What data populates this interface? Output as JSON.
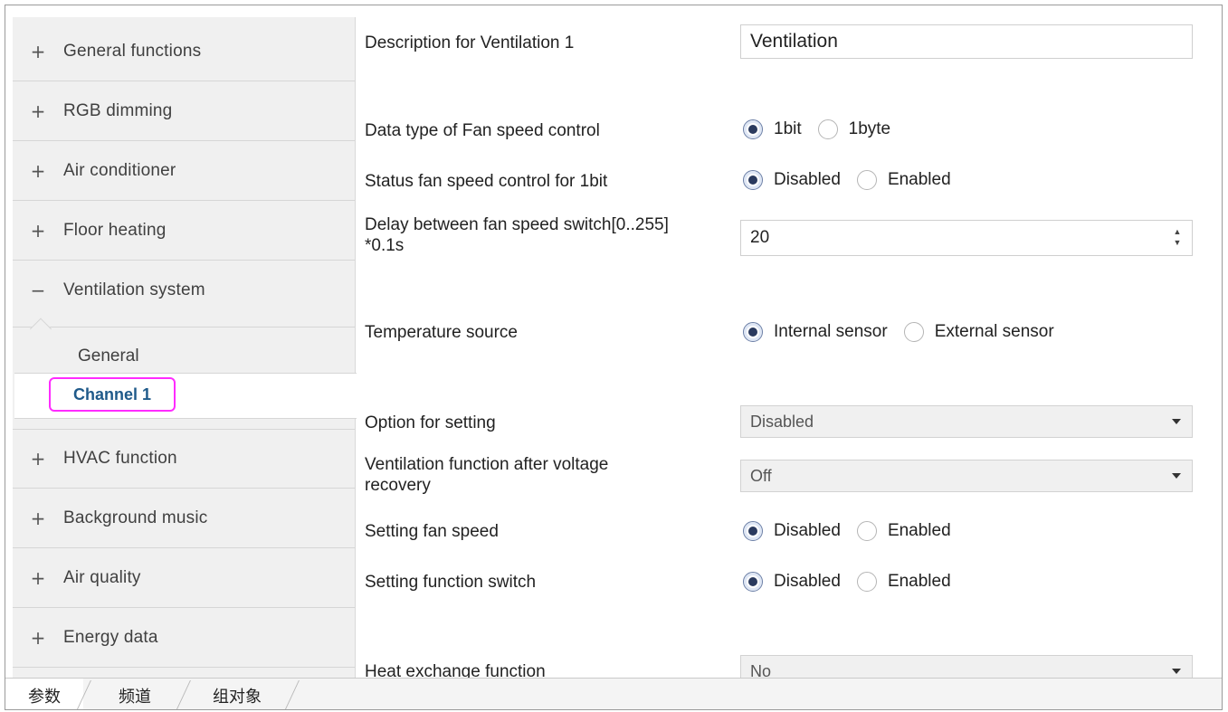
{
  "sidebar": {
    "items": [
      {
        "symbol": "+",
        "label": "General functions"
      },
      {
        "symbol": "+",
        "label": "RGB dimming"
      },
      {
        "symbol": "+",
        "label": "Air conditioner"
      },
      {
        "symbol": "+",
        "label": "Floor heating"
      },
      {
        "symbol": "−",
        "label": "Ventilation system"
      },
      {
        "symbol": "+",
        "label": "HVAC function"
      },
      {
        "symbol": "+",
        "label": "Background music"
      },
      {
        "symbol": "+",
        "label": "Air quality"
      },
      {
        "symbol": "+",
        "label": "Energy data"
      }
    ],
    "sub_general": "General",
    "sub_channel": "Channel 1"
  },
  "params": {
    "description_label": "Description for Ventilation 1",
    "description_value": "Ventilation",
    "datatype_label": "Data type of Fan speed control",
    "datatype_opt1": "1bit",
    "datatype_opt2": "1byte",
    "status_label": "Status fan speed control for 1bit",
    "status_opt1": "Disabled",
    "status_opt2": "Enabled",
    "delay_label_line1": "Delay between fan speed switch[0..255]",
    "delay_label_line2": "*0.1s",
    "delay_value": "20",
    "temp_label": "Temperature source",
    "temp_opt1": "Internal sensor",
    "temp_opt2": "External sensor",
    "option_label": "Option for setting",
    "option_value": "Disabled",
    "vent_label_line1": "Ventilation function after voltage",
    "vent_label_line2": "recovery",
    "vent_value": "Off",
    "fanspeed_label": "Setting fan speed",
    "fanspeed_opt1": "Disabled",
    "fanspeed_opt2": "Enabled",
    "funcswitch_label": "Setting function switch",
    "funcswitch_opt1": "Disabled",
    "funcswitch_opt2": "Enabled",
    "heat_label": "Heat exchange function",
    "heat_value": "No"
  },
  "tabs": [
    "参数",
    "频道",
    "组对象"
  ],
  "colors": {
    "highlight_border": "#ff2bff",
    "selected_text": "#1f5a8a"
  }
}
